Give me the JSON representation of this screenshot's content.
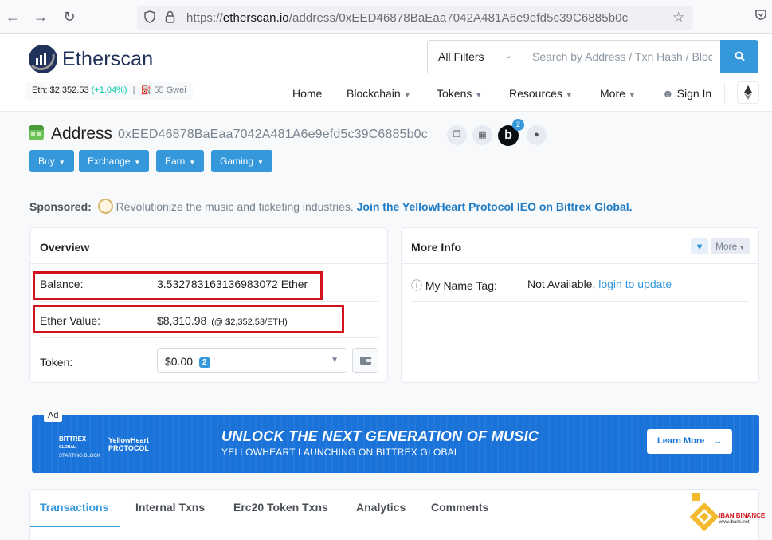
{
  "browser": {
    "url_prefix": "https://",
    "url_host": "etherscan.io",
    "url_path": "/address/0xEED46878BaEaa7042A481A6e9efd5c39C6885b0c"
  },
  "header": {
    "logo_text": "Etherscan",
    "eth_price_label": "Eth: $2,352.53",
    "eth_price_change": "(+1.04%)",
    "separator": "|",
    "gas": "55 Gwei",
    "filter_selected": "All Filters",
    "search_placeholder": "Search by Address / Txn Hash / Block / Token / Ens",
    "nav": [
      {
        "label": "Home"
      },
      {
        "label": "Blockchain"
      },
      {
        "label": "Tokens"
      },
      {
        "label": "Resources"
      },
      {
        "label": "More"
      },
      {
        "label": "Sign In"
      }
    ]
  },
  "address": {
    "label": "Address",
    "hash": "0xEED46878BaEaa7042A481A6e9efd5c39C6885b0c",
    "notification_count": "2",
    "b_label": "b"
  },
  "actions": [
    {
      "label": "Buy"
    },
    {
      "label": "Exchange"
    },
    {
      "label": "Earn"
    },
    {
      "label": "Gaming"
    }
  ],
  "sponsored": {
    "label": "Sponsored:",
    "text": "Revolutionize the music and ticketing industries.",
    "link": "Join the YellowHeart Protocol IEO on Bittrex Global."
  },
  "overview": {
    "title": "Overview",
    "balance_label": "Balance:",
    "balance_value": "3.532783163136983072 Ether",
    "ether_value_label": "Ether Value:",
    "ether_value": "$8,310.98",
    "ether_rate": "(@ $2,352.53/ETH)",
    "token_label": "Token:",
    "token_value": "$0.00",
    "token_count": "2"
  },
  "more_info": {
    "title": "More Info",
    "more_label": "More",
    "name_tag_label": "My Name Tag:",
    "name_tag_value": "Not Available,",
    "name_tag_link": "login to update"
  },
  "ad": {
    "tag": "Ad",
    "logo1_line1": "BITTREX",
    "logo1_line2": "GLOBAL",
    "logo1_line3": "STARTING BLOCK",
    "logo2_line1": "YellowHeart",
    "logo2_line2": "PROTOCOL",
    "headline": "UNLOCK THE NEXT GENERATION OF MUSIC",
    "subline": "YELLOWHEART LAUNCHING ON BITTREX GLOBAL",
    "cta": "Learn More"
  },
  "tabs": [
    {
      "label": "Transactions"
    },
    {
      "label": "Internal Txns"
    },
    {
      "label": "Erc20 Token Txns"
    },
    {
      "label": "Analytics"
    },
    {
      "label": "Comments"
    }
  ],
  "watermark": {
    "line1": "IBAN BINANCE",
    "line2": "www.ibans.net"
  },
  "colors": {
    "accent": "#3498db",
    "highlight_box": "#d3121c",
    "positive": "#00c9a7",
    "brand_navy": "#21325b"
  }
}
